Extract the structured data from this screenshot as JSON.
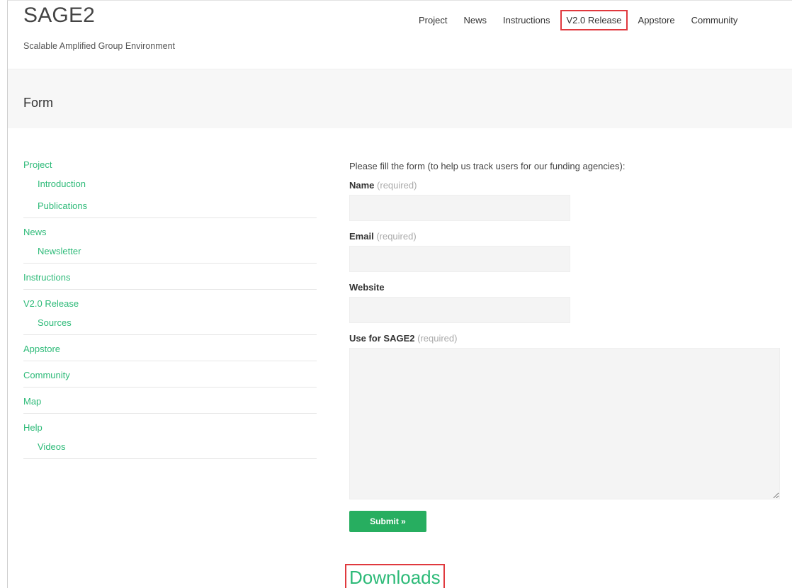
{
  "header": {
    "site_title": "SAGE2",
    "tagline": "Scalable Amplified Group Environment",
    "nav": [
      {
        "label": "Project"
      },
      {
        "label": "News"
      },
      {
        "label": "Instructions"
      },
      {
        "label": "V2.0 Release"
      },
      {
        "label": "Appstore"
      },
      {
        "label": "Community"
      }
    ]
  },
  "title_bar": {
    "title": "Form"
  },
  "sidebar": {
    "groups": [
      {
        "label": "Project",
        "children": [
          "Introduction",
          "Publications"
        ]
      },
      {
        "label": "News",
        "children": [
          "Newsletter"
        ]
      },
      {
        "label": "Instructions",
        "children": []
      },
      {
        "label": "V2.0 Release",
        "children": [
          "Sources"
        ]
      },
      {
        "label": "Appstore",
        "children": []
      },
      {
        "label": "Community",
        "children": []
      },
      {
        "label": "Map",
        "children": []
      },
      {
        "label": "Help",
        "children": [
          "Videos"
        ]
      }
    ]
  },
  "form": {
    "intro": "Please fill the form (to help us track users for our funding agencies):",
    "name_label": "Name",
    "name_req": "(required)",
    "email_label": "Email",
    "email_req": "(required)",
    "website_label": "Website",
    "use_label": "Use for SAGE2",
    "use_req": "(required)",
    "submit_label": "Submit »"
  },
  "downloads": {
    "label": "Downloads"
  },
  "colors": {
    "accent_green": "#2dba78",
    "button_green": "#27ae60",
    "highlight_red": "#e0393e"
  }
}
